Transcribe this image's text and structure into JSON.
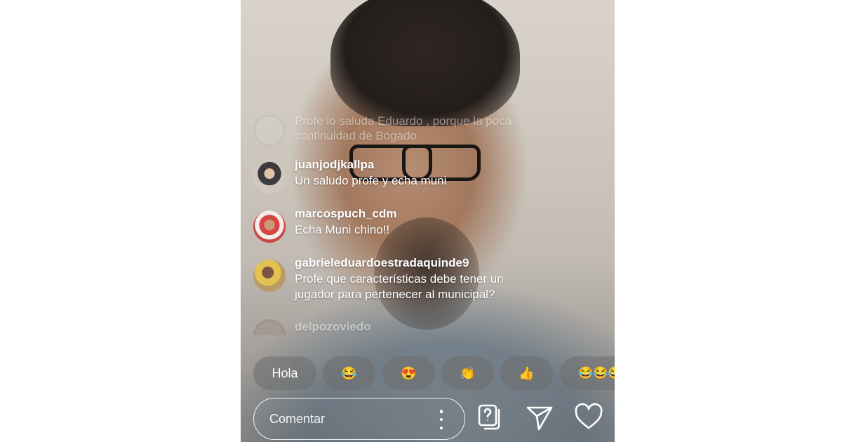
{
  "comments": [
    {
      "user": "",
      "text": "Profe lo saluda Eduardo , porque la poca continuidad de Bogado",
      "avatar_icon": "avatar-icon"
    },
    {
      "user": "juanjodjkallpa",
      "text": "Un saludo profe y echa muni",
      "avatar_icon": "avatar-icon"
    },
    {
      "user": "marcospuch_cdm",
      "text": "Echa Muni chino!!",
      "avatar_icon": "avatar-icon"
    },
    {
      "user": "gabrieleduardoestradaquinde9",
      "text": "Profe que características debe tener un jugador para pertenecer al municipal?",
      "avatar_icon": "avatar-icon"
    },
    {
      "user": "delpozoviedo",
      "text": "",
      "avatar_icon": "avatar-icon"
    }
  ],
  "quick_reactions": [
    "Hola",
    "😂",
    "😍",
    "👏",
    "👍",
    "😂😂😂"
  ],
  "comment_input": {
    "placeholder": "Comentar",
    "value": ""
  },
  "toolbar": {
    "more_icon": "more-vertical-icon",
    "question_icon": "question-icon",
    "share_icon": "send-icon",
    "like_icon": "heart-icon"
  },
  "colors": {
    "chip_bg": "#6e6e6e",
    "text": "#ffffff"
  }
}
